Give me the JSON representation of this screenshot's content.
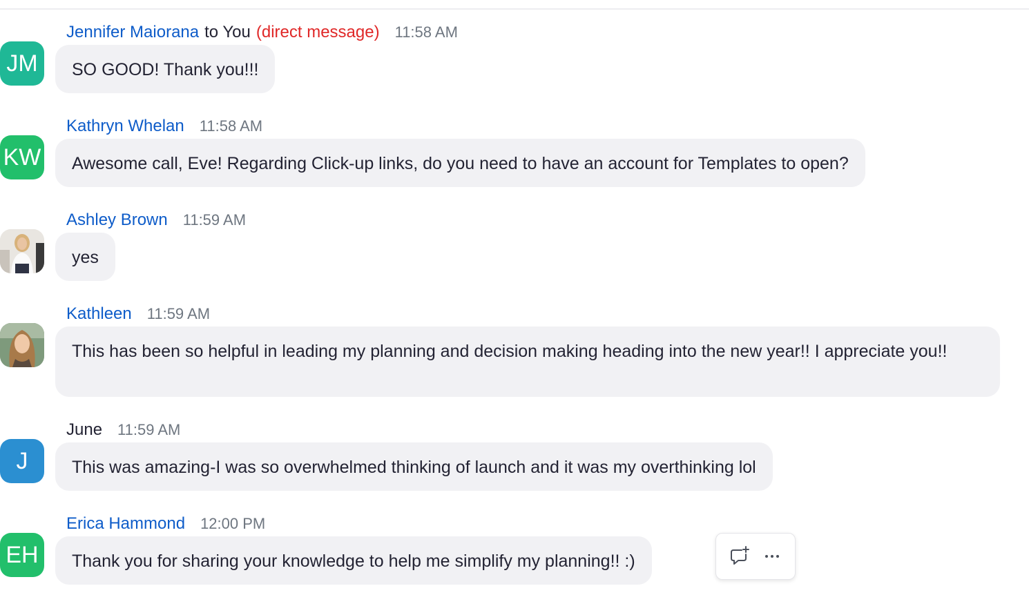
{
  "messages": [
    {
      "avatar": {
        "type": "initials",
        "initials": "JM",
        "color": "#1fb896"
      },
      "sender": "Jennifer Maiorana",
      "to": "to You",
      "dm_label": "(direct message)",
      "time": "11:58 AM",
      "text": "SO GOOD! Thank you!!!"
    },
    {
      "avatar": {
        "type": "initials",
        "initials": "KW",
        "color": "#22bf6b"
      },
      "sender": "Kathryn Whelan",
      "time": "11:58 AM",
      "text": "Awesome call, Eve! Regarding Click-up links, do you need to have an account for Templates to open?"
    },
    {
      "avatar": {
        "type": "photo",
        "description": "profile-photo"
      },
      "sender": "Ashley Brown",
      "time": "11:59 AM",
      "text": "yes"
    },
    {
      "avatar": {
        "type": "photo",
        "description": "profile-photo"
      },
      "sender": "Kathleen",
      "time": "11:59 AM",
      "text": "This has been so helpful in leading my planning and decision making heading into the new year!! I appreciate you!!"
    },
    {
      "avatar": {
        "type": "initials",
        "initials": "J",
        "color": "#2b8fd1"
      },
      "sender": "June",
      "time": "11:59 AM",
      "text": "This was amazing-I was so overwhelmed thinking of launch and it was my overthinking lol"
    },
    {
      "avatar": {
        "type": "initials",
        "initials": "EH",
        "color": "#22bf6b"
      },
      "sender": "Erica Hammond",
      "time": "12:00 PM",
      "text": "Thank you for sharing your knowledge to help me simplify my planning!! :)"
    }
  ],
  "hover_toolbar": {
    "reply_icon": "reply-thread-icon",
    "more_icon": "more-options-icon"
  },
  "colors": {
    "sender_link": "#0e5cc9",
    "direct_message": "#e02828",
    "bubble_bg": "#f1f1f4",
    "timestamp": "#6e7680"
  }
}
